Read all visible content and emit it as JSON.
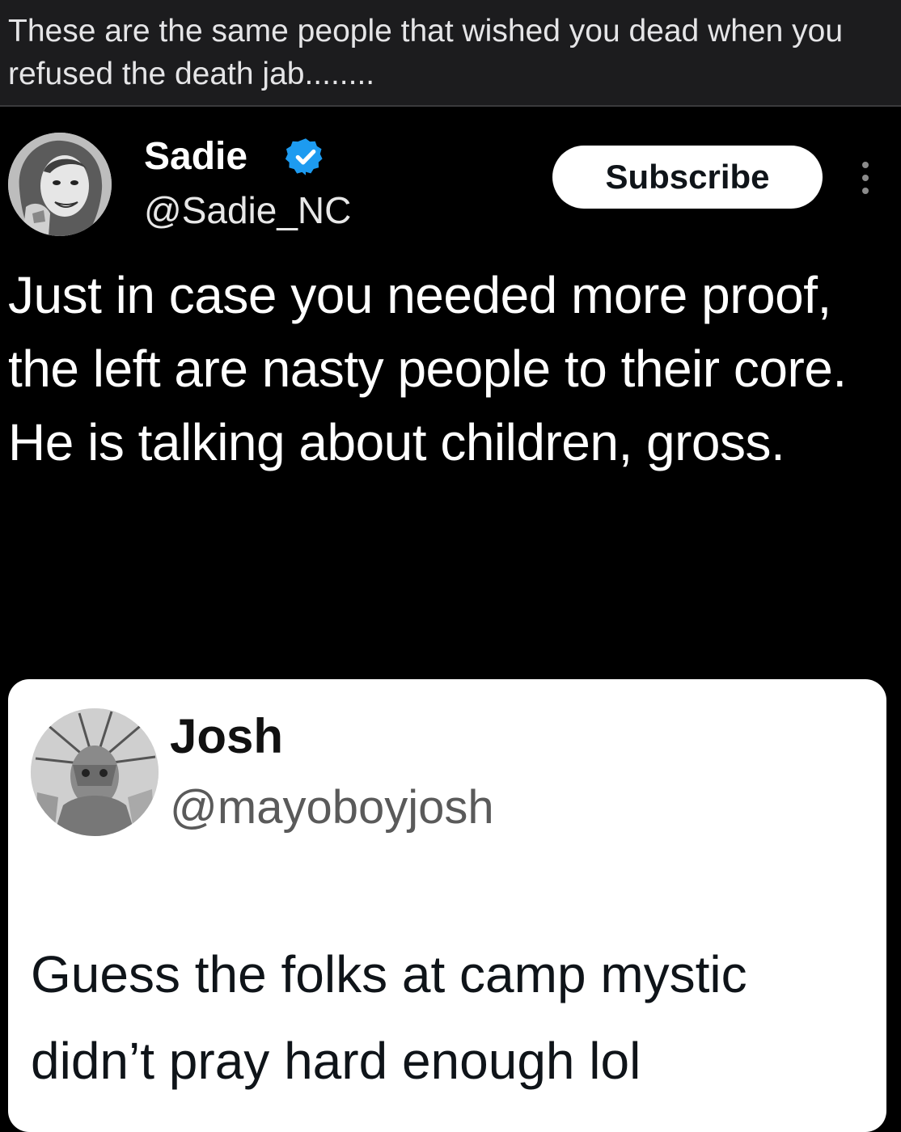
{
  "caption": {
    "text": "These are the same people that wished you dead when you refused the death jab........"
  },
  "tweet": {
    "author": {
      "name": "Sadie",
      "handle": "@Sadie_NC",
      "verified": true,
      "verified_color": "#1d9bf0"
    },
    "subscribe_label": "Subscribe",
    "more_icon": "more-vertical-icon",
    "body_lines": [
      "Just in case you needed more proof, the left are nasty people to their core.",
      "He is talking about children, gross."
    ],
    "quoted": {
      "name": "Josh",
      "handle": "@mayoboyjosh",
      "text": "Guess the folks at camp mystic didn’t pray hard enough lol"
    }
  },
  "colors": {
    "background": "#000000",
    "caption_background": "#1c1c1e",
    "quote_card_background": "#ffffff",
    "subscribe_background": "#ffffff"
  }
}
